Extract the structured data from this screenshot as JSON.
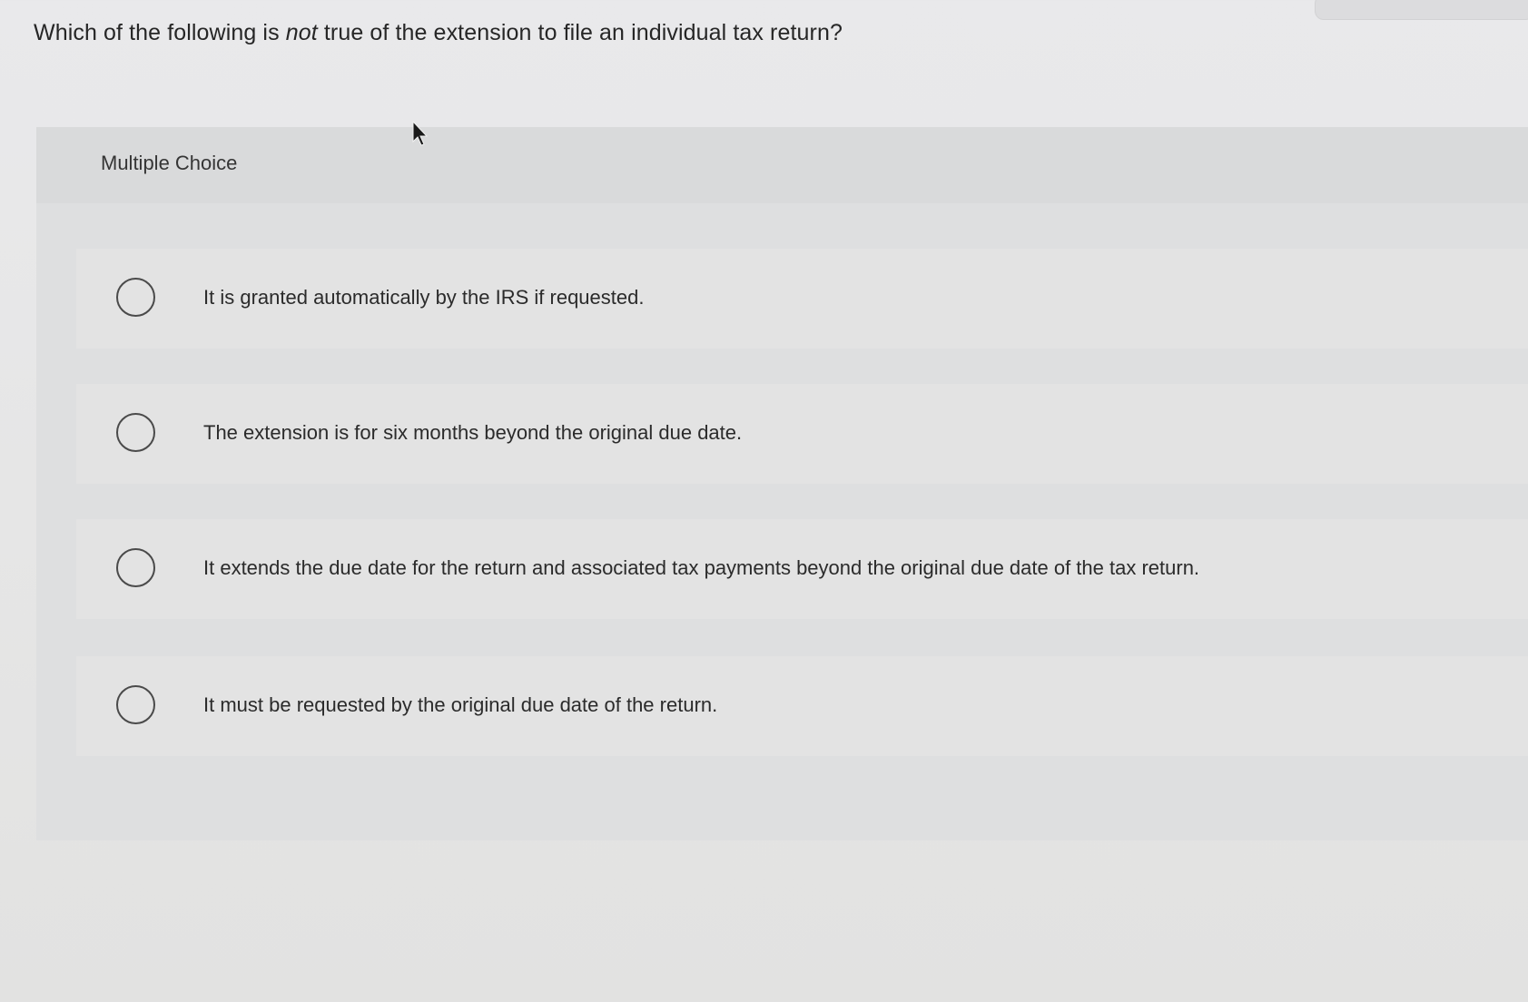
{
  "question": {
    "before": "Which of the following is ",
    "emphasis": "not",
    "after": " true of the extension to file an individual tax return?"
  },
  "multiple_choice": {
    "label": "Multiple Choice",
    "options": [
      {
        "text": "It is granted automatically by the IRS if requested.",
        "selected": false
      },
      {
        "text": "The extension is for six months beyond the original due date.",
        "selected": false
      },
      {
        "text": "It extends the due date for the return and associated tax payments beyond the original due date of the tax return.",
        "selected": false
      },
      {
        "text": "It must be requested by the original due date of the return.",
        "selected": false
      }
    ]
  },
  "icons": {
    "cursor": "mouse-pointer-icon",
    "radio": "radio-unchecked-icon"
  }
}
